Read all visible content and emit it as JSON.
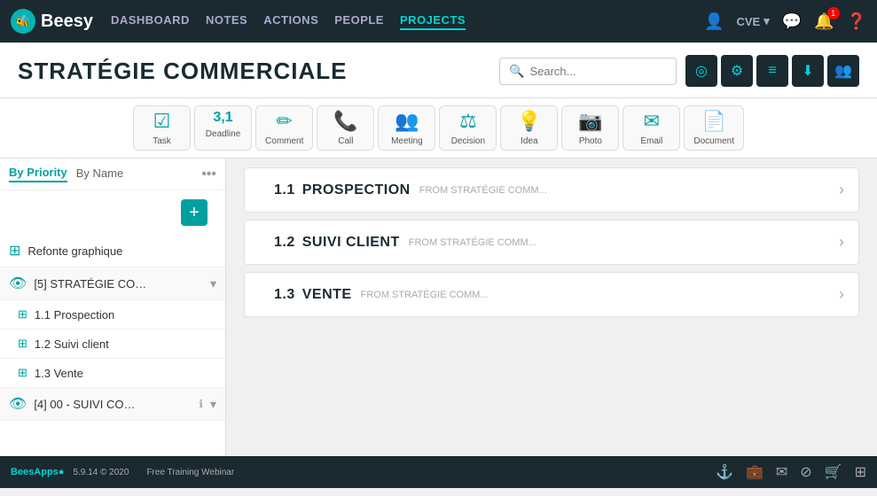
{
  "app": {
    "name": "Beesy",
    "version": "5.9.14 © 2020",
    "training": "Free Training Webinar"
  },
  "nav": {
    "links": [
      {
        "label": "DASHBOARD",
        "active": false
      },
      {
        "label": "NOTES",
        "active": false
      },
      {
        "label": "ACTIONS",
        "active": false
      },
      {
        "label": "PEOPLE",
        "active": false
      },
      {
        "label": "PROJECTS",
        "active": true
      }
    ],
    "user": "CVE"
  },
  "page": {
    "title": "STRATÉGIE COMMERCIALE"
  },
  "search": {
    "placeholder": "Search..."
  },
  "action_types": [
    {
      "label": "Task",
      "icon": "☑"
    },
    {
      "label": "Deadline",
      "icon": "3,1"
    },
    {
      "label": "Comment",
      "icon": "✏"
    },
    {
      "label": "Call",
      "icon": "📞"
    },
    {
      "label": "Meeting",
      "icon": "👥"
    },
    {
      "label": "Decision",
      "icon": "⚖"
    },
    {
      "label": "Idea",
      "icon": "💡"
    },
    {
      "label": "Photo",
      "icon": "📷"
    },
    {
      "label": "Email",
      "icon": "✉"
    },
    {
      "label": "Document",
      "icon": "📄"
    }
  ],
  "sidebar": {
    "tabs": [
      {
        "label": "By Priority",
        "active": true
      },
      {
        "label": "By Name",
        "active": false
      }
    ],
    "items": [
      {
        "label": "Refonte graphique",
        "type": "project",
        "indent": false
      },
      {
        "label": "[5] STRATÉGIE CO…",
        "type": "project-parent",
        "indent": false,
        "badge": "5"
      },
      {
        "label": "1.1 Prospection",
        "type": "sub",
        "indent": true
      },
      {
        "label": "1.2 Suivi client",
        "type": "sub",
        "indent": true
      },
      {
        "label": "1.3 Vente",
        "type": "sub",
        "indent": true
      },
      {
        "label": "[4] 00 - SUIVI CO…",
        "type": "project-parent",
        "indent": false,
        "badge": "4"
      }
    ]
  },
  "projects": [
    {
      "number": "1.1",
      "name": "PROSPECTION",
      "source": "FROM STRATÉGIE COMM..."
    },
    {
      "number": "1.2",
      "name": "SUIVI CLIENT",
      "source": "FROM STRATÉGIE COMM..."
    },
    {
      "number": "1.3",
      "name": "VENTE",
      "source": "FROM STRATÉGIE COMM..."
    }
  ],
  "toolbar": {
    "icons": [
      "◎",
      "⚙",
      "≡",
      "⬇",
      "👥"
    ]
  }
}
